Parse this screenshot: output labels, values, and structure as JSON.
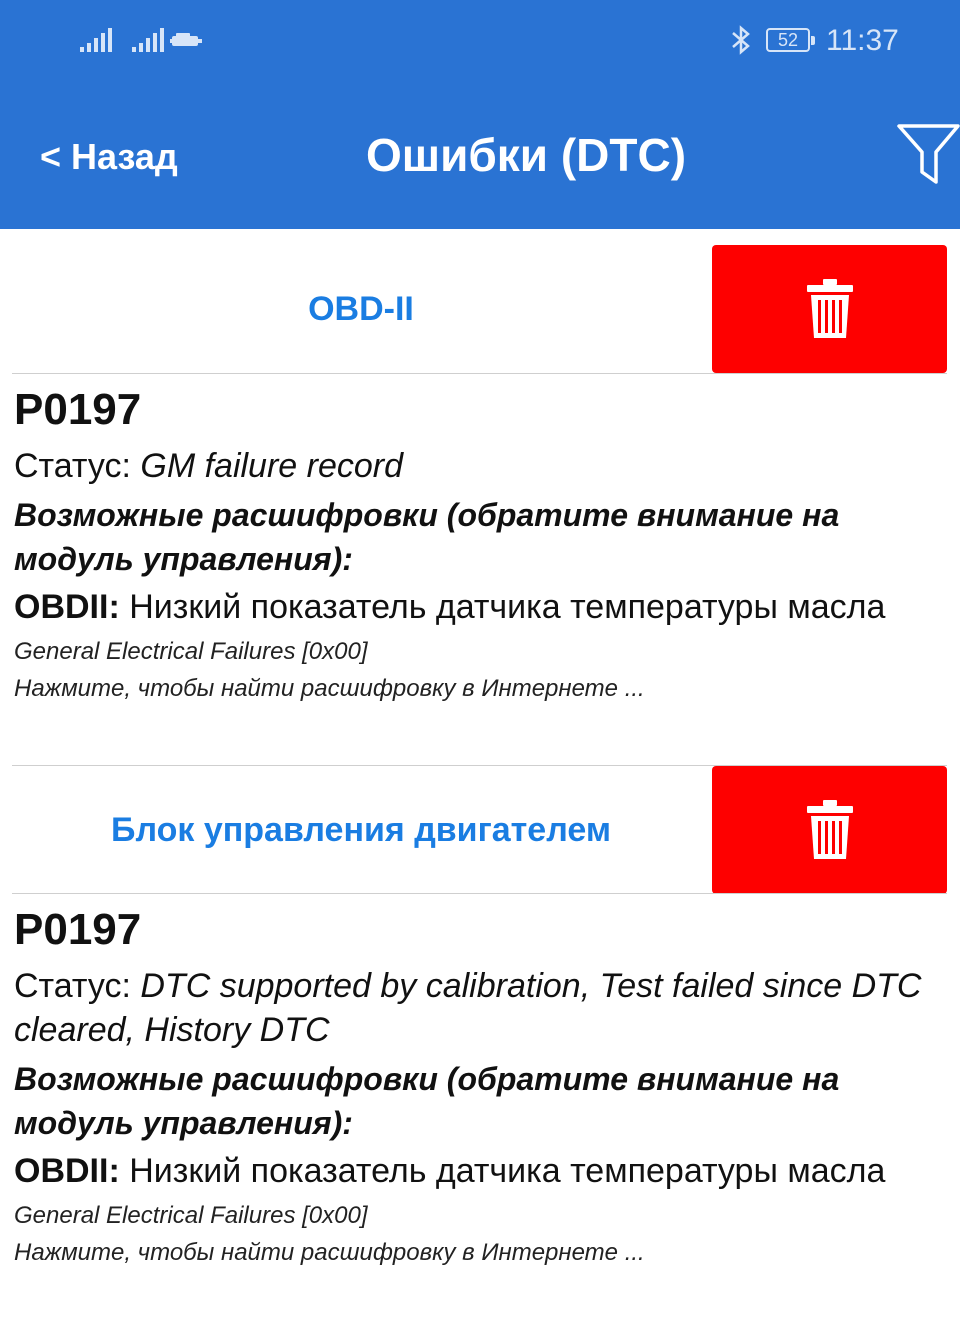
{
  "status_bar": {
    "time": "11:37",
    "battery": "52",
    "icons": [
      "signal-icon",
      "signal-icon",
      "car-icon",
      "bluetooth-icon",
      "battery-icon"
    ]
  },
  "header": {
    "back_label": "< Назад",
    "title": "Ошибки (DTC)",
    "filter_icon": "filter-icon"
  },
  "colors": {
    "appbar": "#2a73d3",
    "module_label": "#1a7de2",
    "delete_button": "#fe0000"
  },
  "modules": [
    {
      "label": "OBD-II",
      "delete_icon": "trash-icon",
      "code": "P0197",
      "status_prefix": "Статус: ",
      "status_value": "GM failure record",
      "possible_label": "Возможные расшифровки (обратите внимание на модуль управления):",
      "obd_prefix": "OBDII:",
      "obd_text": " Низкий показатель датчика температуры масла",
      "failure_type": "General Electrical Failures [0x00]",
      "search_hint": "Нажмите, чтобы найти расшифровку в Интернете ..."
    },
    {
      "label": "Блок управления двигателем",
      "delete_icon": "trash-icon",
      "code": "P0197",
      "status_prefix": "Статус: ",
      "status_value": "DTC supported by calibration, Test failed since DTC cleared, History DTC",
      "possible_label": "Возможные расшифровки (обратите внимание на модуль управления):",
      "obd_prefix": "OBDII:",
      "obd_text": " Низкий показатель датчика температуры масла",
      "failure_type": "General Electrical Failures [0x00]",
      "search_hint": "Нажмите, чтобы найти расшифровку в Интернете ..."
    }
  ]
}
